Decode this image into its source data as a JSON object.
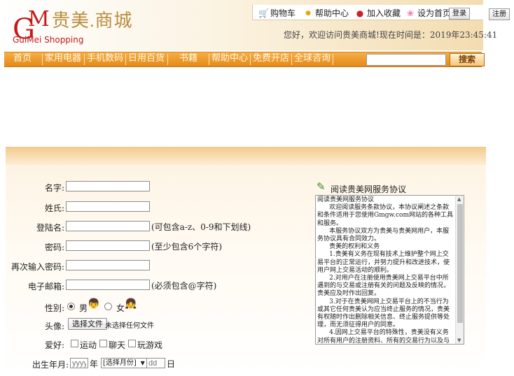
{
  "logo": {
    "g": "G",
    "m": "M",
    "cn": "贵美.商城",
    "en": "GuiMei Shopping"
  },
  "top_links": {
    "cart": "购物车",
    "help": "帮助中心",
    "favorite": "加入收藏",
    "homepage": "设为首页",
    "login": "登录",
    "register": "注册"
  },
  "welcome": "您好，欢迎访问贵美商城!现在时间是：2019年23:45:41",
  "nav": [
    "首页",
    "家用电器",
    "手机数码",
    "日用百货",
    "书籍",
    "帮助中心",
    "免费开店",
    "全球咨询"
  ],
  "search": {
    "button": "搜索",
    "value": ""
  },
  "form": {
    "name_label": "名字:",
    "surname_label": "姓氏:",
    "login_label": "登陆名:",
    "login_hint": "(可包含a-z、0-9和下划线)",
    "password_label": "密码:",
    "password_hint": "(至少包含6个字符)",
    "repassword_label": "再次输入密码:",
    "email_label": "电子邮箱:",
    "email_hint": "(必须包含@字符)",
    "gender_label": "性别:",
    "gender_male": "男",
    "gender_female": "女",
    "avatar_label": "头像:",
    "file_button": "选择文件",
    "file_status": "未选择任何文件",
    "hobby_label": "爱好:",
    "hobbies": [
      "运动",
      "聊天",
      "玩游戏"
    ],
    "birth_label": "出生年月:",
    "year_placeholder": "yyyy",
    "year_unit": "年",
    "month_select": "[选择月份]",
    "day_placeholder": "dd",
    "day_unit": "日"
  },
  "agreement": {
    "title": "阅读贵美网服务协议",
    "text": "阅读贵美网服务协议\n      欢迎阅读服务条款协议，本协议阐述之条款和条件适用于您使用Gmgw.com网站的各种工具和服务。\n      本服务协议双方为贵美与贵美网用户，本服务协议具有合同效力。\n      贵美的权利和义务\n      1.贵美有义务在现有技术上维护整个网上交易平台的正常运行，并努力提升和改进技术，使用户网上交易活动的顺利。\n      2.对用户在注册使用贵美网上交易平台中所遇到的与交易或注册有关的问题及反映的情况，贵美应及时作出回复。\n      3.对于在贵美网网上交易平台上的不当行为或其它任何贵美认为应当终止服务的情况，贵美有权随时作出删除相关信息、终止服务提供等处理，而无须征得用户的同意。\n      4.因网上交易平台的特殊性，贵美没有义务对所有用户的注册资料、所有的交易行为以及与交易有关的其他事项进行事先审查。"
  }
}
